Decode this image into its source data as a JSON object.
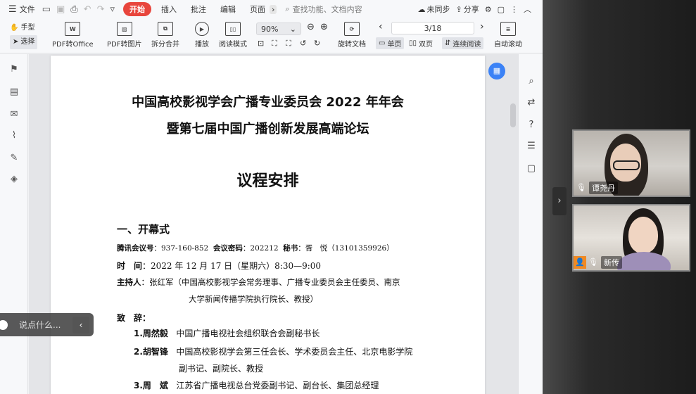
{
  "menubar": {
    "file": "文件",
    "start_tab": "开始",
    "tabs": [
      "插入",
      "批注",
      "编辑",
      "页面"
    ],
    "search_placeholder": "查找功能、文档内容",
    "unsync": "未同步",
    "share": "分享"
  },
  "toolbar": {
    "hand": "手型",
    "select": "选择",
    "pdf_to_office": "PDF转Office",
    "pdf_to_image": "PDF转图片",
    "split_merge": "拆分合并",
    "play": "播放",
    "read_mode": "阅读模式",
    "zoom": "90%",
    "rotate_doc": "旋转文档",
    "page_indicator": "3/18",
    "single_page": "单页",
    "double_page": "双页",
    "continuous": "连续阅读",
    "auto_scroll": "自动滚动"
  },
  "document": {
    "title1": "中国高校影视学会广播专业委员会 2022 年年会",
    "title2": "暨第七届中国广播创新发展高端论坛",
    "title3": "议程安排",
    "section1": "一、开幕式",
    "meeting_line": {
      "id_label": "腾讯会议号",
      "id_value": "：937-160-852",
      "pw_label": "会议密码",
      "pw_value": "：202212",
      "sec_label": "秘书",
      "sec_value": "：胥　悦（13101359926）"
    },
    "time_label": "时　间",
    "time_value": "：2022 年 12 月 17 日（星期六）8:30—9:00",
    "host_label": "主持人",
    "host_value": "：张红军（中国高校影视学会常务理事、广播专业委员会主任委员、南京",
    "host_value2": "大学新闻传播学院执行院长、教授）",
    "speech_label": "致　辞：",
    "speakers": [
      {
        "num": "1.周然毅",
        "desc": "中国广播电视社会组织联合会副秘书长"
      },
      {
        "num": "2.胡智锋",
        "desc": "中国高校影视学会第三任会长、学术委员会主任、北京电影学院"
      },
      {
        "num": "",
        "desc": "副书记、副院长、教授"
      },
      {
        "num": "3.周　斌",
        "desc": "江苏省广播电视总台党委副书记、副台长、集团总经理"
      }
    ]
  },
  "chat": {
    "placeholder": "说点什么..."
  },
  "video": {
    "participant1": "谭尧丹",
    "participant2": "新传"
  },
  "colors": {
    "accent": "#e8453c",
    "blue": "#3b82f6",
    "avatar_orange": "#f08a24"
  }
}
